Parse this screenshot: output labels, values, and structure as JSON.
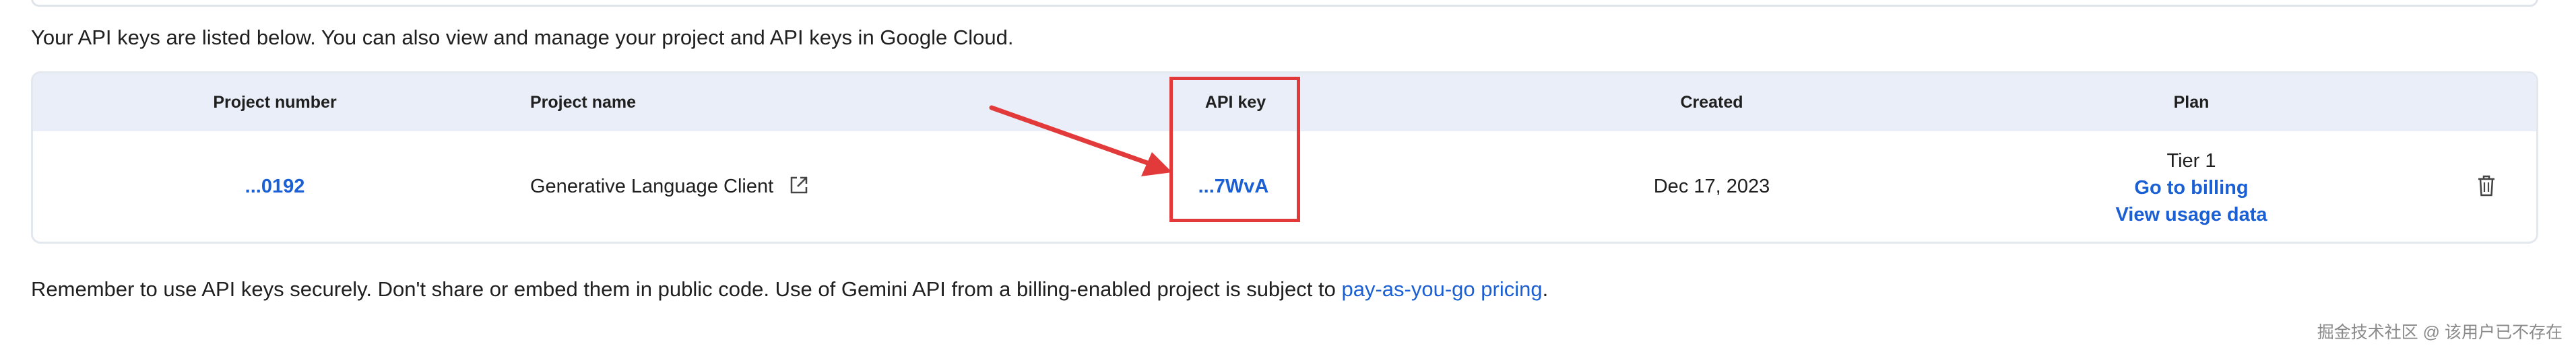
{
  "intro": "Your API keys are listed below. You can also view and manage your project and API keys in Google Cloud.",
  "table": {
    "headers": {
      "project_number": "Project number",
      "project_name": "Project name",
      "api_key": "API key",
      "created": "Created",
      "plan": "Plan"
    },
    "row": {
      "project_number": "...0192",
      "project_name": "Generative Language Client",
      "api_key": "...7WvA",
      "created": "Dec 17, 2023",
      "plan_tier": "Tier 1",
      "go_to_billing": "Go to billing",
      "view_usage": "View usage data"
    }
  },
  "footer": {
    "text": "Remember to use API keys securely. Don't share or embed them in public code. Use of Gemini API from a billing-enabled project is subject to ",
    "link": "pay-as-you-go pricing",
    "end": "."
  },
  "watermark": "掘金技术社区 @ 该用户已不存在",
  "icons": {
    "external_link": "external-link-icon",
    "delete": "trash-icon"
  },
  "colors": {
    "link": "#1a5fd4",
    "header_bg": "#e9eef8",
    "annotation": "#e23a3a"
  }
}
